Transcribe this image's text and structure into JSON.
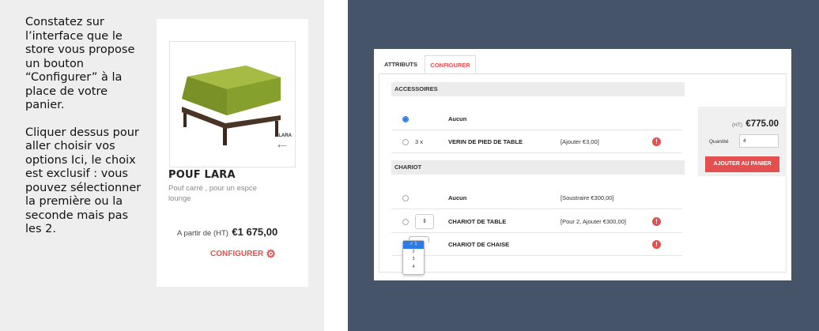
{
  "instructions": {
    "paragraph1": "Constatez sur l’interface que le store vous propose un bouton “Configurer” à la place de votre panier.",
    "paragraph2": "Cliquer dessus pour aller choisir vos options Ici, le choix est exclusif : vous pouvez sélectionner la première ou la seconde mais pas les 2."
  },
  "product": {
    "image_label": "LARA",
    "name": "POUF LARA",
    "description": "Pouf carré , pour un espce lounge",
    "price_prefix": "A partir de (HT)",
    "price": "€1 675,00",
    "configure_label": "CONFIGURER",
    "configure_icon": "gear-icon"
  },
  "configurator": {
    "tabs": [
      {
        "label": "ATTRIBUTS",
        "active": false
      },
      {
        "label": "CONFIGURER",
        "active": true
      }
    ],
    "sections": [
      {
        "title": "ACCESSOIRES",
        "rows": [
          {
            "name": "Aucun",
            "checked": true,
            "qty": "",
            "price": "",
            "info": false
          },
          {
            "name": "VERIN DE PIED DE TABLE",
            "checked": false,
            "qty": "3 x",
            "price": "[Ajouter €3,00]",
            "info": true
          }
        ]
      },
      {
        "title": "CHARIOT",
        "rows": [
          {
            "name": "Aucun",
            "checked": false,
            "qty": "",
            "price": "[Soustraire €300,00]",
            "info": false
          },
          {
            "name": "CHARIOT DE TABLE",
            "checked": false,
            "qty": "stepper",
            "price": "[Pour 2, Ajouter €300,00]",
            "info": true
          },
          {
            "name": "CHARIOT DE CHAISE",
            "checked": true,
            "qty": "dropdown",
            "price": "",
            "info": true
          }
        ]
      }
    ],
    "stepper_symbol": "⇕",
    "dropdown_options": [
      "1",
      "2",
      "3",
      "4"
    ],
    "dropdown_selected": "1",
    "cart": {
      "ht_label": "(HT)",
      "price": "€775.00",
      "quantity_label": "Quantité",
      "quantity_value": "4",
      "button_label": "AJOUTER AU PANIER"
    }
  },
  "colors": {
    "accent": "#e4504f",
    "right_background": "#455469",
    "left_background": "#eeeeee",
    "radio_selected": "#2d7be5",
    "sofa_green": "#8ea632"
  }
}
